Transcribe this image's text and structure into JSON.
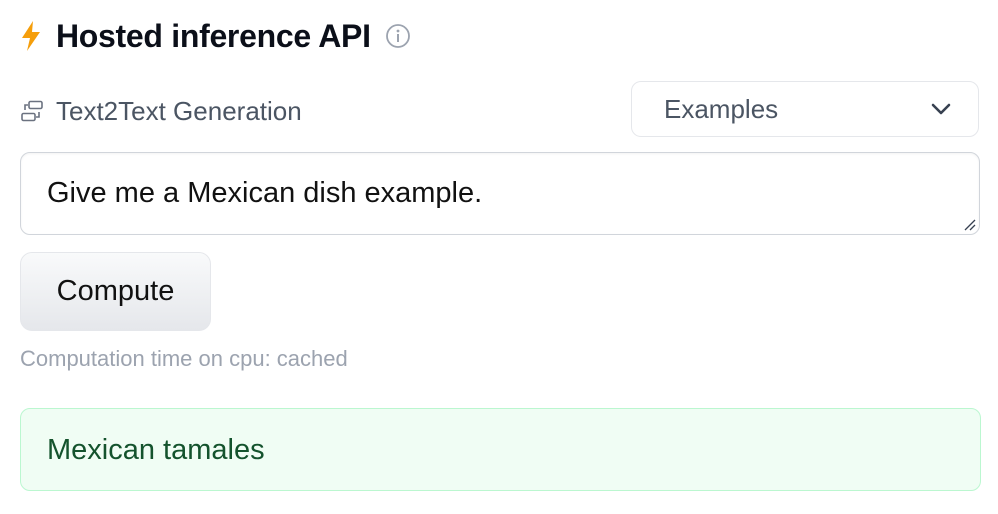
{
  "header": {
    "title": "Hosted inference API",
    "bolt_icon": "lightning-bolt-icon",
    "info_icon": "info-circle-icon",
    "accent_color": "#f59e0b"
  },
  "task": {
    "icon": "text2text-task-icon",
    "label": "Text2Text Generation"
  },
  "examples": {
    "label": "Examples",
    "icon": "chevron-down-icon"
  },
  "input": {
    "value": "Give me a Mexican dish example."
  },
  "compute": {
    "label": "Compute"
  },
  "status": {
    "computation_time": "Computation time on cpu: cached"
  },
  "output": {
    "text": "Mexican tamales",
    "background_color": "#f0fdf4",
    "border_color": "#bbf7d0",
    "text_color": "#14532d"
  }
}
